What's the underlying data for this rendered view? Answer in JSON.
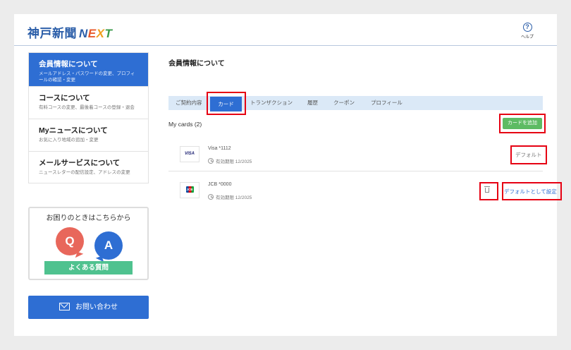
{
  "header": {
    "logo_kobe": "神戸新聞",
    "logo_next": [
      "N",
      "E",
      "X",
      "T"
    ],
    "help_icon": "?",
    "help_label": "ヘルプ"
  },
  "sidebar": {
    "items": [
      {
        "title": "会員情報について",
        "desc": "メールアドレス・パスワードの変更、プロフィールの確認・変更",
        "active": true
      },
      {
        "title": "コースについて",
        "desc": "有料コースの変更、最後着コースの登録・退会"
      },
      {
        "title": "Myニュースについて",
        "desc": "お気に入り地域の追加・変更"
      },
      {
        "title": "メールサービスについて",
        "desc": "ニュースレターの配信設定、アドレスの変更"
      }
    ],
    "faq": {
      "heading": "お困りのときはこちらから",
      "q": "Q",
      "a": "A",
      "button": "よくある質問"
    },
    "contact_button": "お問い合わせ"
  },
  "main": {
    "title": "会員情報について",
    "tabs": [
      "ご契約内容",
      "カード",
      "トランザクション",
      "履歴",
      "クーポン",
      "プロフィール"
    ],
    "active_tab": "カード",
    "cards_label": "My cards (2)",
    "add_card_button": "カードを追加",
    "cards": [
      {
        "brand": "VISA",
        "number": "Visa *1112",
        "expiry": "有効期限 12/2025",
        "status": "デフォルト"
      },
      {
        "brand": "JCB",
        "number": "JCB *0000",
        "expiry": "有効期限 12/2025",
        "action": "デフォルトとして設定"
      }
    ]
  },
  "colors": {
    "primary": "#2e6ed3",
    "highlight": "#e60012",
    "faq_button": "#4fc28f",
    "add_button": "#5dbb63",
    "tab_bar": "#dbe9f7"
  }
}
